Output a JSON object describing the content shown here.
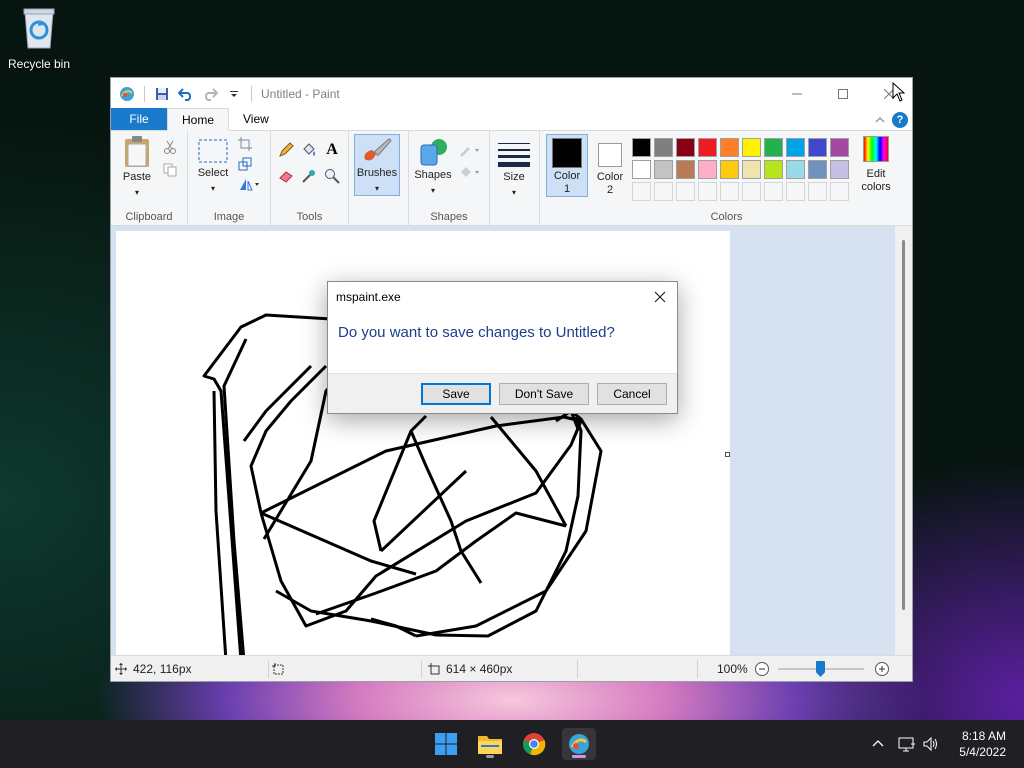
{
  "desktop": {
    "recycle_bin_label": "Recycle bin"
  },
  "window": {
    "title": "Untitled - Paint",
    "tabs": {
      "file": "File",
      "home": "Home",
      "view": "View"
    }
  },
  "ribbon": {
    "clipboard": {
      "name": "Clipboard",
      "paste": "Paste"
    },
    "image": {
      "name": "Image",
      "select": "Select"
    },
    "tools": {
      "name": "Tools"
    },
    "brushes": {
      "label": "Brushes"
    },
    "shapes": {
      "name": "Shapes",
      "label": "Shapes"
    },
    "size": {
      "label": "Size"
    },
    "colors": {
      "name": "Colors",
      "color1_line1": "Color",
      "color1_line2": "1",
      "color2_line1": "Color",
      "color2_line2": "2",
      "edit_line1": "Edit",
      "edit_line2": "colors",
      "color1_value": "#000000",
      "color2_value": "#ffffff",
      "palette_row1": [
        "#000000",
        "#7f7f7f",
        "#880015",
        "#ed1c24",
        "#ff7f27",
        "#fff200",
        "#22b14c",
        "#00a2e8",
        "#3f48cc",
        "#a349a4"
      ],
      "palette_row2": [
        "#ffffff",
        "#c3c3c3",
        "#b97a57",
        "#ffaec9",
        "#ffc90e",
        "#efe4b0",
        "#b5e61d",
        "#99d9ea",
        "#7092be",
        "#c8bfe7"
      ]
    }
  },
  "statusbar": {
    "cursor_pos": "422, 116px",
    "image_size": "614 × 460px",
    "zoom": "100%",
    "zoom_level": 1.0
  },
  "dialog": {
    "title": "mspaint.exe",
    "message": "Do you want to save changes to Untitled?",
    "save": "Save",
    "dont_save": "Don't Save",
    "cancel": "Cancel"
  },
  "taskbar": {
    "time": "8:18 AM",
    "date": "5/4/2022"
  }
}
